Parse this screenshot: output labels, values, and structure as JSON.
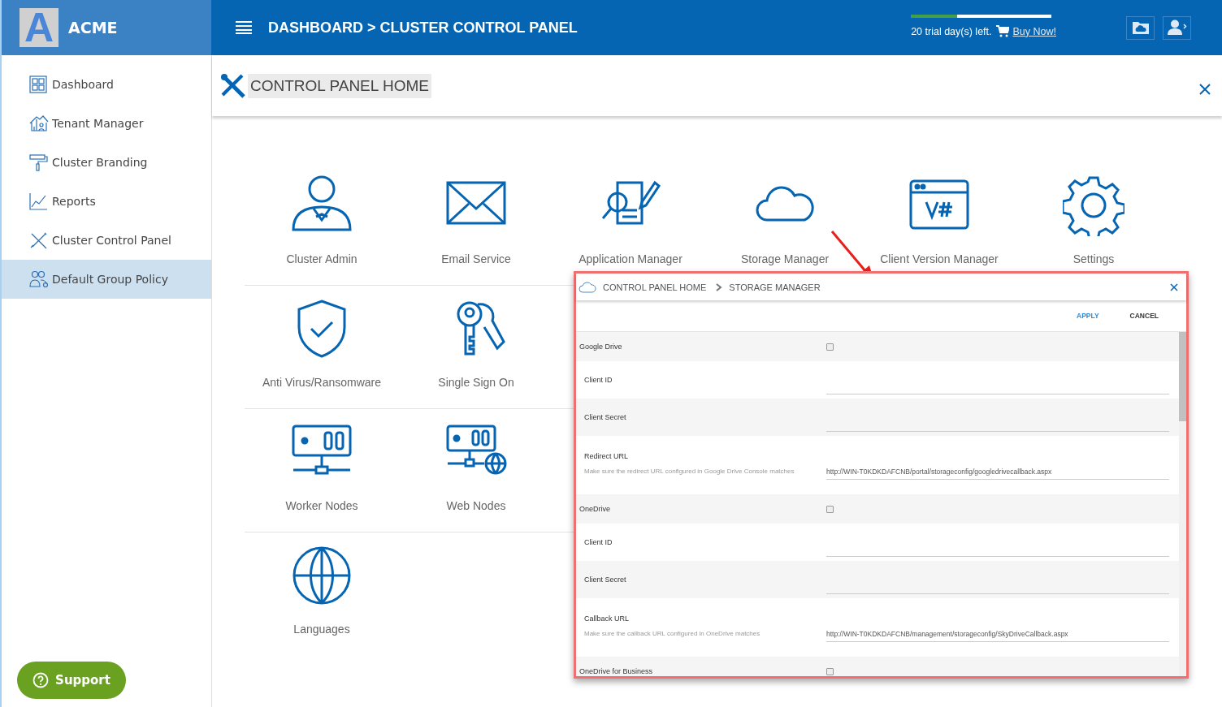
{
  "header": {
    "logo_letter": "A",
    "brand": "ACME",
    "breadcrumb": "DASHBOARD > CLUSTER CONTROL PANEL",
    "trial": {
      "level": 0.33,
      "text": "20 trial day(s) left.",
      "link": "Buy Now!"
    }
  },
  "sidebar": {
    "items": [
      {
        "label": "Dashboard",
        "kind": "grid",
        "selected": false
      },
      {
        "label": "Tenant Manager",
        "kind": "house",
        "selected": false
      },
      {
        "label": "Cluster Branding",
        "kind": "roller",
        "selected": false
      },
      {
        "label": "Reports",
        "kind": "chart",
        "selected": false
      },
      {
        "label": "Cluster Control Panel",
        "kind": "tools",
        "selected": false
      },
      {
        "label": "Default Group Policy",
        "kind": "group",
        "selected": true
      }
    ]
  },
  "support": "Support",
  "page": {
    "title": "CONTROL PANEL HOME"
  },
  "tile_rows": [
    [
      {
        "label": "Cluster Admin",
        "kind": "admin"
      },
      {
        "label": "Email Service",
        "kind": "mail"
      },
      {
        "label": "Application Manager",
        "kind": "app"
      },
      {
        "label": "Storage Manager",
        "kind": "cloud"
      },
      {
        "label": "Client Version Manager",
        "kind": "version"
      },
      {
        "label": "Settings",
        "kind": "gear"
      }
    ],
    [
      {
        "label": "Anti Virus/Ransomware",
        "kind": "shield"
      },
      {
        "label": "Single Sign On",
        "kind": "keys"
      }
    ],
    [
      {
        "label": "Worker Nodes",
        "kind": "server"
      },
      {
        "label": "Web Nodes",
        "kind": "webserver"
      }
    ],
    [
      {
        "label": "Languages",
        "kind": "globe"
      }
    ]
  ],
  "dialog": {
    "breadcrumb": [
      "CONTROL PANEL HOME",
      "STORAGE MANAGER"
    ],
    "actions": [
      {
        "label": "APPLY",
        "kind": "primary"
      },
      {
        "label": "CANCEL",
        "kind": "secondary"
      }
    ],
    "rows": [
      {
        "kind": "section",
        "label": "Google Drive",
        "checked": false
      },
      {
        "kind": "field",
        "label": "Client ID"
      },
      {
        "kind": "field",
        "label": "Client Secret"
      },
      {
        "kind": "field",
        "label": "Redirect URL",
        "hint": "Make sure the redirect URL configured in Google Drive Console matches",
        "value": "http://WIN-T0KDKDAFCNB/portal/storageconfig/googledrivecallback.aspx"
      },
      {
        "kind": "section",
        "label": "OneDrive",
        "checked": false
      },
      {
        "kind": "field",
        "label": "Client ID"
      },
      {
        "kind": "field",
        "label": "Client Secret"
      },
      {
        "kind": "field",
        "label": "Callback URL",
        "hint": "Make sure the callback URL configured in OneDrive matches",
        "value": "http://WIN-T0KDKDAFCNB/management/storageconfig/SkyDriveCallback.aspx"
      },
      {
        "kind": "section",
        "label": "OneDrive for Business",
        "checked": false
      }
    ]
  }
}
